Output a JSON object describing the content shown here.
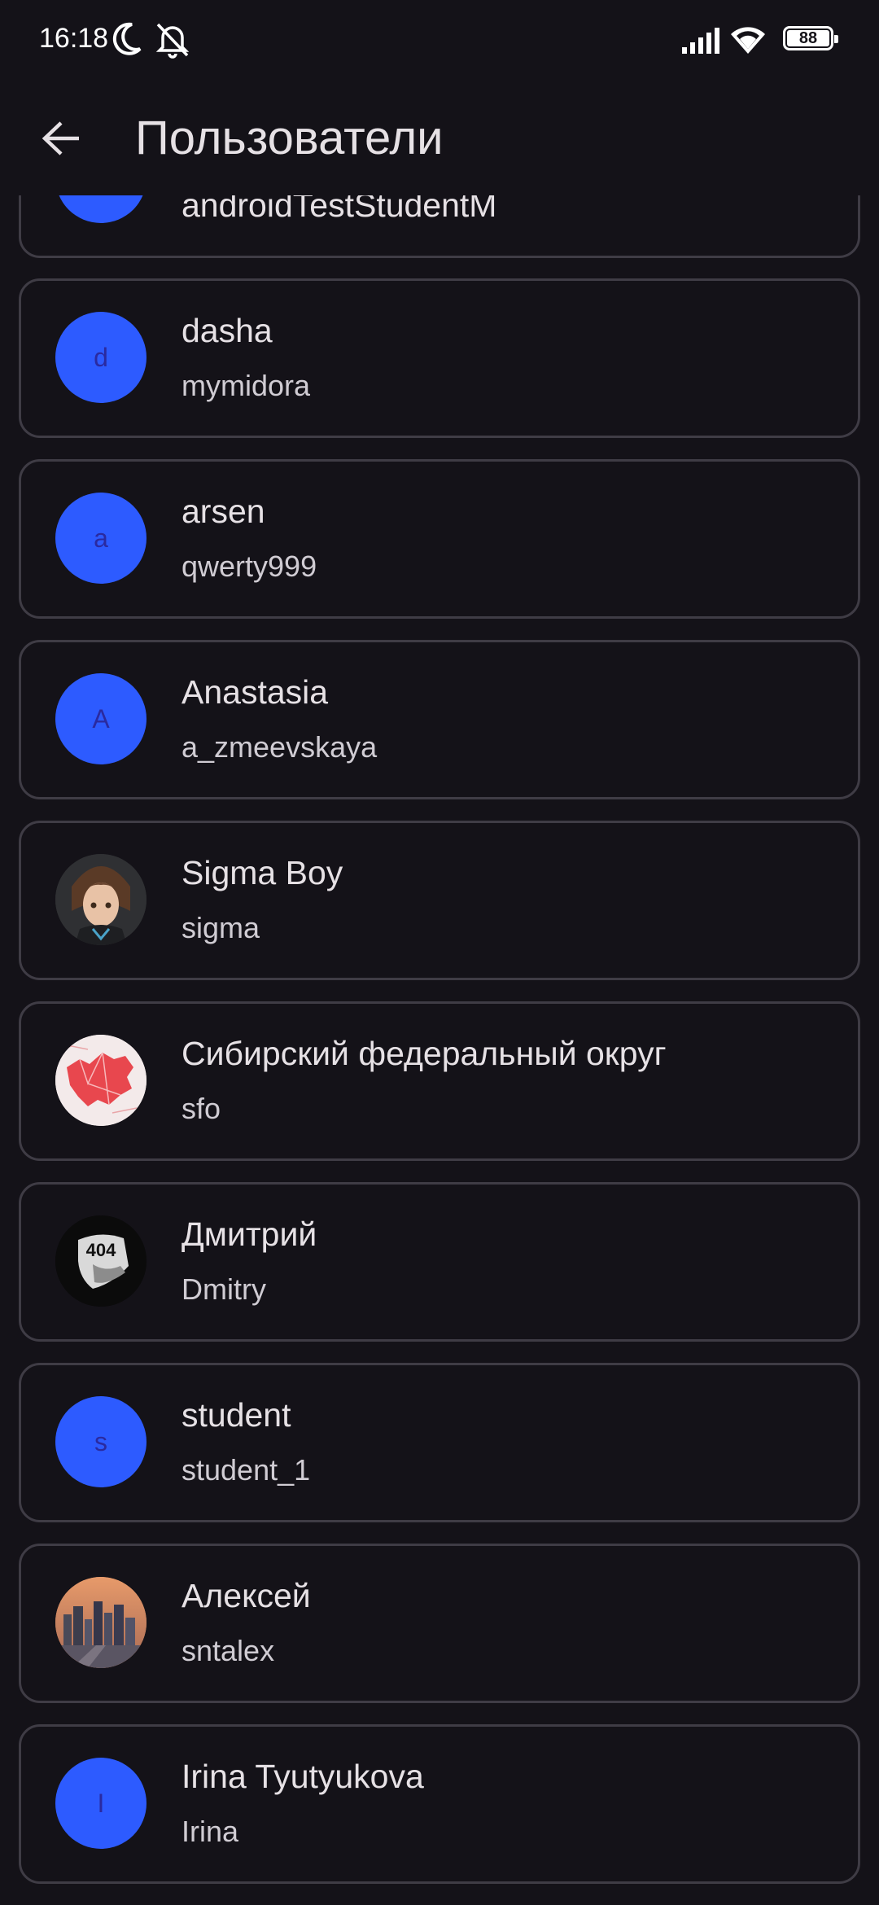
{
  "status_bar": {
    "time": "16:18",
    "icons": [
      "moon-icon",
      "mute-icon",
      "signal-icon",
      "wifi-icon",
      "battery-icon"
    ],
    "battery": "88"
  },
  "app_bar": {
    "title": "Пользователи",
    "back_icon": "arrow-back-icon"
  },
  "colors": {
    "background": "#141218",
    "card_border": "#3f3c45",
    "avatar_default": "#2d5bff",
    "text_primary": "#e6e1e5"
  },
  "users": [
    {
      "name": "androidTestStudentM",
      "login": "",
      "avatar_letter": "",
      "avatar_type": "letter"
    },
    {
      "name": "dasha",
      "login": "mymidora",
      "avatar_letter": "d",
      "avatar_type": "letter"
    },
    {
      "name": "arsen",
      "login": "qwerty999",
      "avatar_letter": "a",
      "avatar_type": "letter"
    },
    {
      "name": "Anastasia",
      "login": "a_zmeevskaya",
      "avatar_letter": "A",
      "avatar_type": "letter"
    },
    {
      "name": "Sigma Boy",
      "login": "sigma",
      "avatar_letter": "",
      "avatar_type": "photo-anime-boy"
    },
    {
      "name": "Сибирский федеральный округ",
      "login": "sfo",
      "avatar_letter": "",
      "avatar_type": "photo-map"
    },
    {
      "name": "Дмитрий",
      "login": "Dmitry",
      "avatar_letter": "",
      "avatar_type": "photo-404"
    },
    {
      "name": "student",
      "login": "student_1",
      "avatar_letter": "s",
      "avatar_type": "letter"
    },
    {
      "name": "Алексей",
      "login": "sntalex",
      "avatar_letter": "",
      "avatar_type": "photo-city"
    },
    {
      "name": "Irina Tyutyukova",
      "login": "Irina",
      "avatar_letter": "I",
      "avatar_type": "letter"
    }
  ],
  "avatar_photo_texts": {
    "photo_404": "404"
  }
}
